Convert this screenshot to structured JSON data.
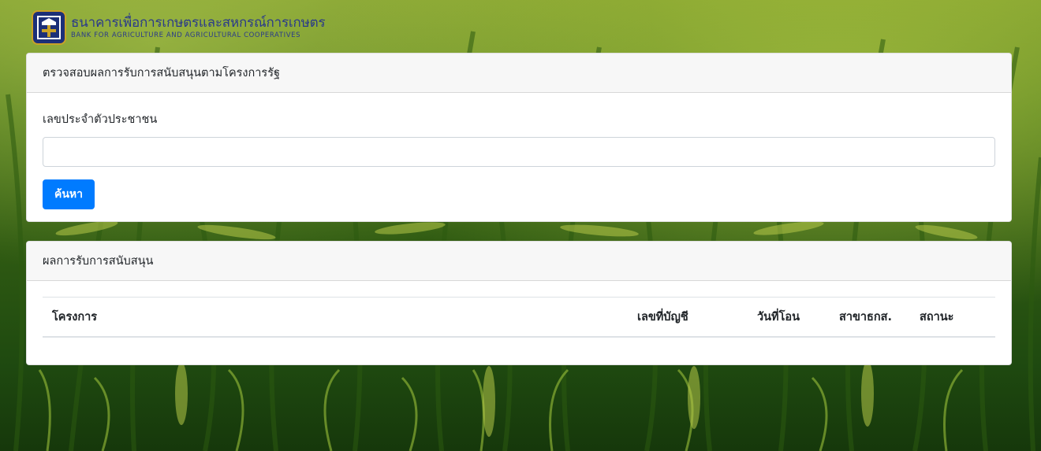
{
  "header": {
    "logo_icon": "baac-logo-icon",
    "bank_name_th": "ธนาคารเพื่อการเกษตรและสหกรณ์การเกษตร",
    "bank_name_en": "BANK FOR AGRICULTURE AND AGRICULTURAL COOPERATIVES"
  },
  "search_card": {
    "title": "ตรวจสอบผลการรับการสนับสนุนตามโครงการรัฐ",
    "id_label": "เลขประจำตัวประชาชน",
    "id_value": "",
    "search_button": "ค้นหา"
  },
  "results_card": {
    "title": "ผลการรับการสนับสนุน",
    "columns": [
      "โครงการ",
      "เลขที่บัญชี",
      "วันที่โอน",
      "สาขาธกส.",
      "สถานะ"
    ],
    "rows": []
  },
  "colors": {
    "primary_button": "#007bff",
    "logo_blue": "#1c2f78",
    "logo_gold": "#c9a227"
  }
}
